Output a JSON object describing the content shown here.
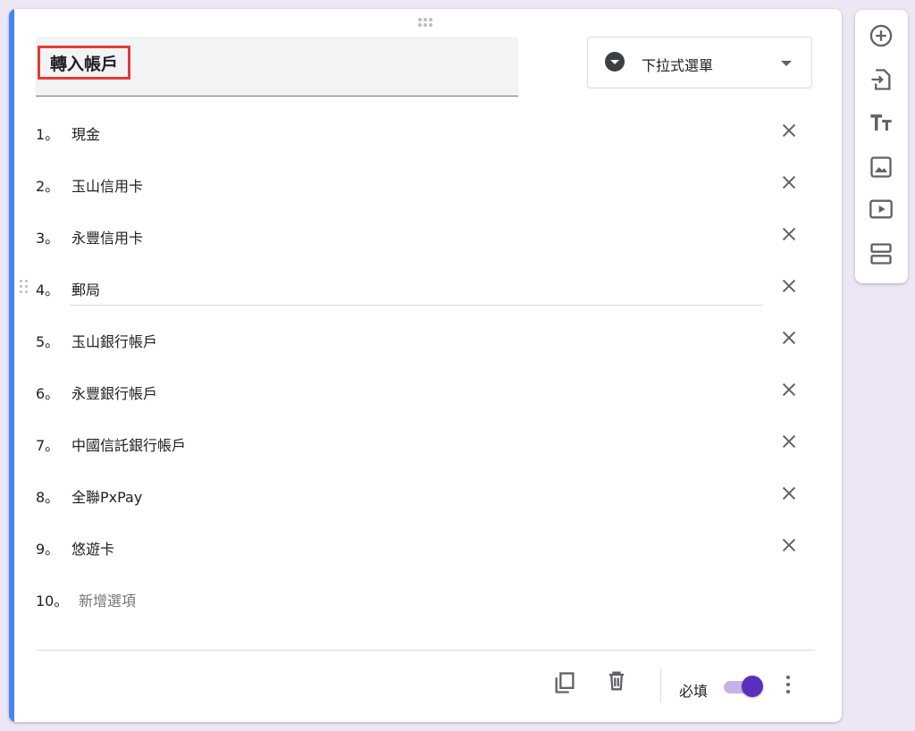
{
  "question": {
    "title": "轉入帳戶",
    "type_label": "下拉式選單"
  },
  "options": [
    {
      "num": "1。",
      "label": "現金"
    },
    {
      "num": "2。",
      "label": "玉山信用卡"
    },
    {
      "num": "3。",
      "label": "永豐信用卡"
    },
    {
      "num": "4。",
      "label": "郵局"
    },
    {
      "num": "5。",
      "label": "玉山銀行帳戶"
    },
    {
      "num": "6。",
      "label": "永豐銀行帳戶"
    },
    {
      "num": "7。",
      "label": "中國信託銀行帳戶"
    },
    {
      "num": "8。",
      "label": "全聯PxPay"
    },
    {
      "num": "9。",
      "label": "悠遊卡"
    }
  ],
  "add_option": {
    "num": "10。",
    "label": "新增選項"
  },
  "footer": {
    "required_label": "必填",
    "required_on": true
  },
  "icons": {
    "type": "dropdown-circle-icon",
    "remove": "close-icon",
    "copy": "copy-icon",
    "delete": "trash-icon",
    "more": "more-vert-icon",
    "toolbar": [
      "add-circle-icon",
      "import-icon",
      "title-text-icon",
      "image-icon",
      "video-icon",
      "section-icon"
    ]
  },
  "colors": {
    "accent": "#4285f4",
    "toggle": "#5b2fbd",
    "highlight_box": "#e53935"
  }
}
